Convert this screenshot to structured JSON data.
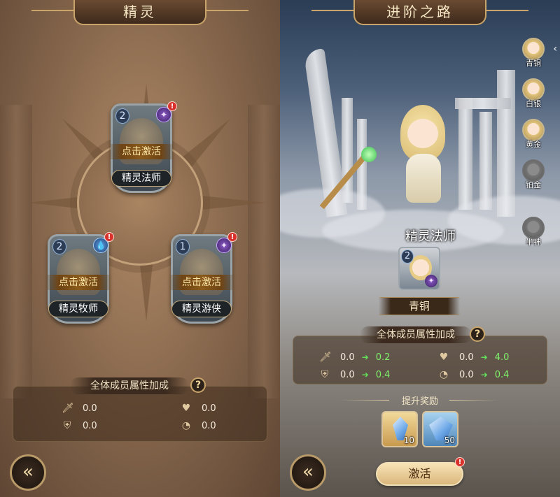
{
  "left_panel": {
    "title": "精灵",
    "cards": [
      {
        "name": "精灵法师",
        "level": "2",
        "activate_label": "点击激活",
        "element_icon": "arcane-icon",
        "alert": "!"
      },
      {
        "name": "精灵牧师",
        "level": "2",
        "activate_label": "点击激活",
        "element_icon": "water-drop-icon",
        "alert": "!"
      },
      {
        "name": "精灵游侠",
        "level": "1",
        "activate_label": "点击激活",
        "element_icon": "arcane-icon",
        "alert": "!"
      }
    ],
    "attributes": {
      "header": "全体成员属性加成",
      "help": "?",
      "stats": [
        {
          "icon": "sword-icon",
          "value": "0.0"
        },
        {
          "icon": "heart-icon",
          "value": "0.0"
        },
        {
          "icon": "shield-icon",
          "value": "0.0"
        },
        {
          "icon": "speed-icon",
          "value": "0.0"
        }
      ]
    },
    "back_icon": "back-arrow-icon"
  },
  "right_panel": {
    "title": "进阶之路",
    "hero_name": "精灵法师",
    "hero_level": "2",
    "rank": "青铜",
    "tiers": [
      {
        "label": "青铜",
        "locked": false
      },
      {
        "label": "白银",
        "locked": false
      },
      {
        "label": "黄金",
        "locked": false
      },
      {
        "label": "铂金",
        "locked": true
      },
      {
        "label": "半神",
        "locked": true
      }
    ],
    "attributes": {
      "header": "全体成员属性加成",
      "help": "?",
      "stats": [
        {
          "icon": "sword-icon",
          "from": "0.0",
          "to": "0.2"
        },
        {
          "icon": "heart-icon",
          "from": "0.0",
          "to": "4.0"
        },
        {
          "icon": "shield-icon",
          "from": "0.0",
          "to": "0.4"
        },
        {
          "icon": "speed-icon",
          "from": "0.0",
          "to": "0.4"
        }
      ]
    },
    "reward_title": "提升奖励",
    "rewards": [
      {
        "icon": "blue-crystal-icon",
        "qty": "10"
      },
      {
        "icon": "crystal-cluster-icon",
        "qty": "50"
      }
    ],
    "activate_button": "激活",
    "alert": "!"
  },
  "colors": {
    "gold": "#c9a56a",
    "alert_red": "#d8322c",
    "increase_green": "#7ef06a"
  }
}
